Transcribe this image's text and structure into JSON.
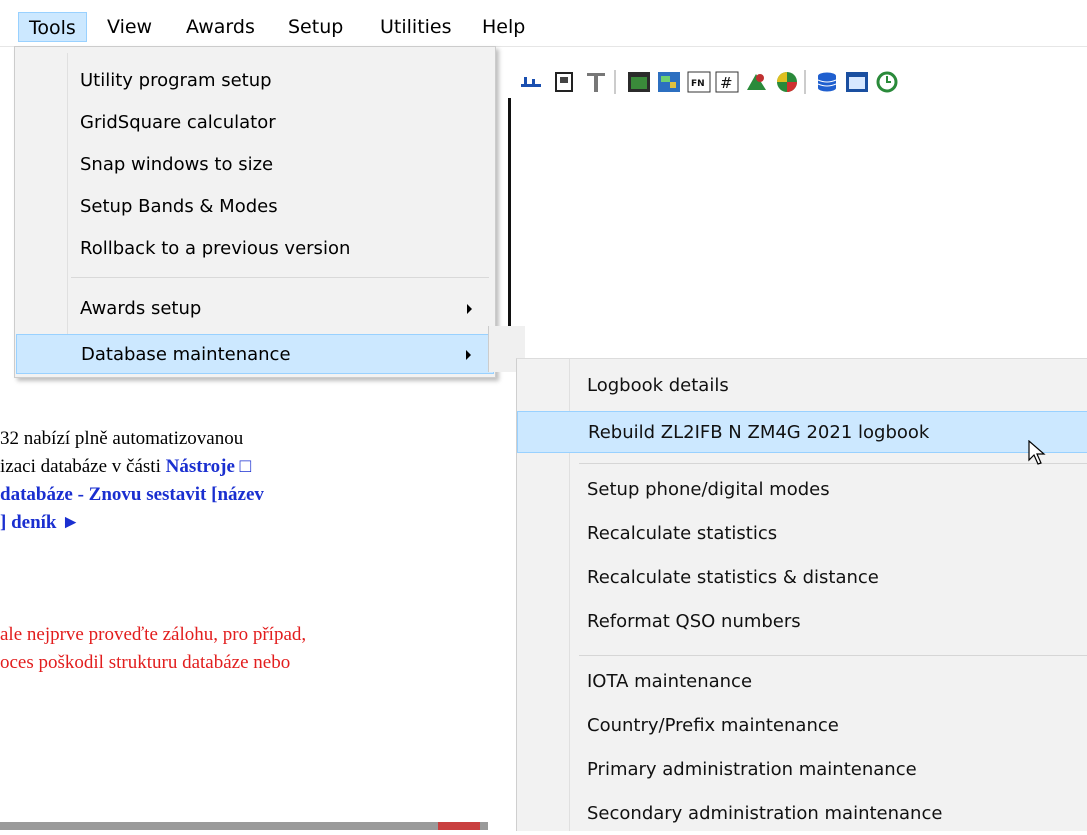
{
  "menubar": {
    "items": [
      "Tools",
      "View",
      "Awards",
      "Setup",
      "Utilities",
      "Help"
    ]
  },
  "tools_menu": {
    "items": [
      "Utility program setup",
      "GridSquare calculator",
      "Snap windows to size",
      "Setup Bands & Modes",
      "Rollback to a previous version"
    ],
    "awards_setup": "Awards setup",
    "database_maintenance": "Database maintenance"
  },
  "db_submenu": {
    "logbook_details": "Logbook details",
    "rebuild": "Rebuild ZL2IFB N ZM4G 2021 logbook",
    "group2": [
      "Setup phone/digital modes",
      "Recalculate statistics",
      "Recalculate statistics & distance",
      "Reformat QSO numbers"
    ],
    "group3": [
      "IOTA maintenance",
      "Country/Prefix maintenance",
      "Primary administration maintenance",
      "Secondary administration maintenance"
    ]
  },
  "document": {
    "line1": "32 nabízí plně automatizovanou",
    "line2_plain": "izaci databáze v části ",
    "line2_bold": "Nástroje □",
    "line3": " databáze - Znovu sestavit [název",
    "line4": "] deník ►",
    "red1": " ale nejprve proveďte zálohu, pro případ,",
    "red2": "oces poškodil strukturu databáze nebo"
  }
}
